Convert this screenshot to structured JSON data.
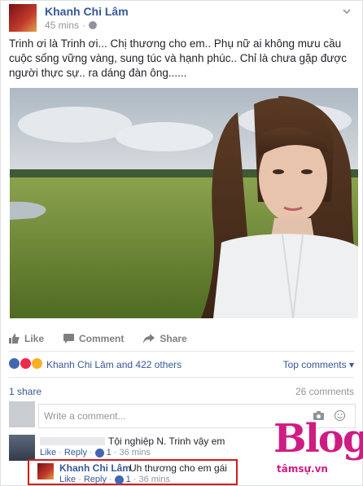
{
  "post": {
    "author": "Khanh Chi Lâm",
    "time": "45 mins",
    "text": "Trinh ơi là Trinh ơi... Chị thương cho em.. Phụ nữ ai không mưu cầu cuộc sống vững vàng, sung túc và hạnh phúc.. Chỉ là chưa gặp được người thực sự.. ra dáng đàn ông......"
  },
  "actions": {
    "like": "Like",
    "comment": "Comment",
    "share": "Share"
  },
  "reactions": {
    "summary": "Khanh Chi Lâm and 422 others",
    "sort": "Top comments"
  },
  "stats": {
    "shares": "1 share",
    "comments": "26 comments"
  },
  "comment_input": {
    "placeholder": "Write a comment..."
  },
  "comments": [
    {
      "text": "Tội nghiệp N. Trinh vậy em",
      "like": "Like",
      "reply": "Reply",
      "likes": "1",
      "time": "36 mins"
    },
    {
      "author": "Khanh Chi Lâm",
      "text": "Uh thương cho em gái",
      "like": "Like",
      "reply": "Reply",
      "likes": "1",
      "time": "36 mins"
    }
  ],
  "watermark": {
    "brand": "Blog",
    "site": "tâmsự.vn"
  },
  "colors": {
    "link": "#365899",
    "highlight": "#d31c1c",
    "watermark": "#cf1c83"
  }
}
